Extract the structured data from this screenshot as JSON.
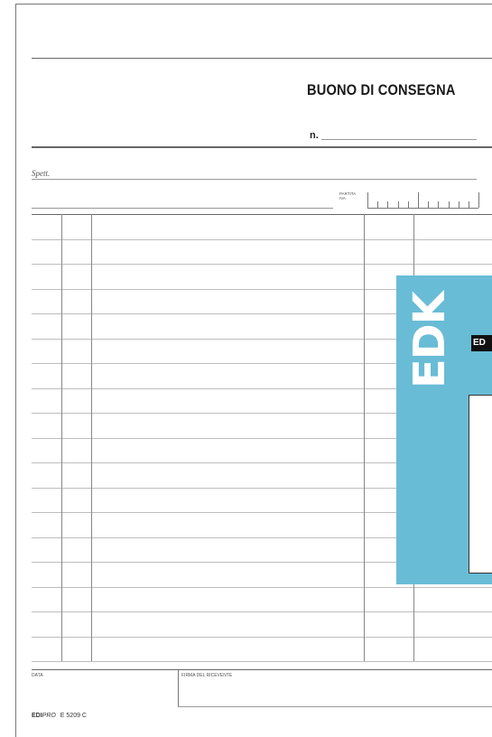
{
  "form": {
    "title": "BUONO DI CONSEGNA",
    "number_label": "n.",
    "recipient_label": "Spett.",
    "vat_label_line1": "PARTITA",
    "vat_label_line2": "IVA",
    "date_label": "DATA",
    "signature_label": "FIRMA DEL RICEVENTE",
    "table_row_count": 18
  },
  "footer": {
    "brand_bold": "EDI",
    "brand_light": "PRO",
    "product_code": "E 5209 C"
  },
  "cover": {
    "brand": "EDK",
    "mini_logo": "ED",
    "color": "#69bcd6"
  }
}
